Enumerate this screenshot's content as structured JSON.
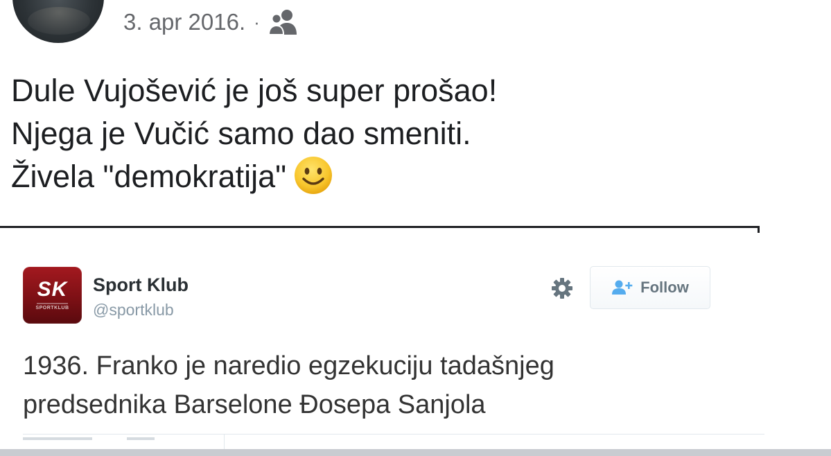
{
  "post": {
    "date": "3. apr 2016.",
    "separator": "·",
    "audience_icon": "friends-icon",
    "text_lines": [
      "Dule Vujošević je još super prošao!",
      "Njega je Vučić samo dao smeniti.",
      "Živela \"demokratija\""
    ],
    "emoji": "slightly-smiling-face"
  },
  "tweet": {
    "logo": {
      "main": "SK",
      "sub": "SPORTKLUB"
    },
    "account_name": "Sport Klub",
    "account_handle": "@sportklub",
    "settings_icon": "gear-icon",
    "follow_label": "Follow",
    "follow_icon": "add-user-icon",
    "text_lines": [
      "1936. Franko je naredio egzekuciju tadašnjeg",
      "predsednika Barselone Đosepa Sanjola"
    ]
  },
  "colors": {
    "brand_red": "#a3191f",
    "meta_gray": "#65676b",
    "handle_gray": "#8899a6"
  }
}
